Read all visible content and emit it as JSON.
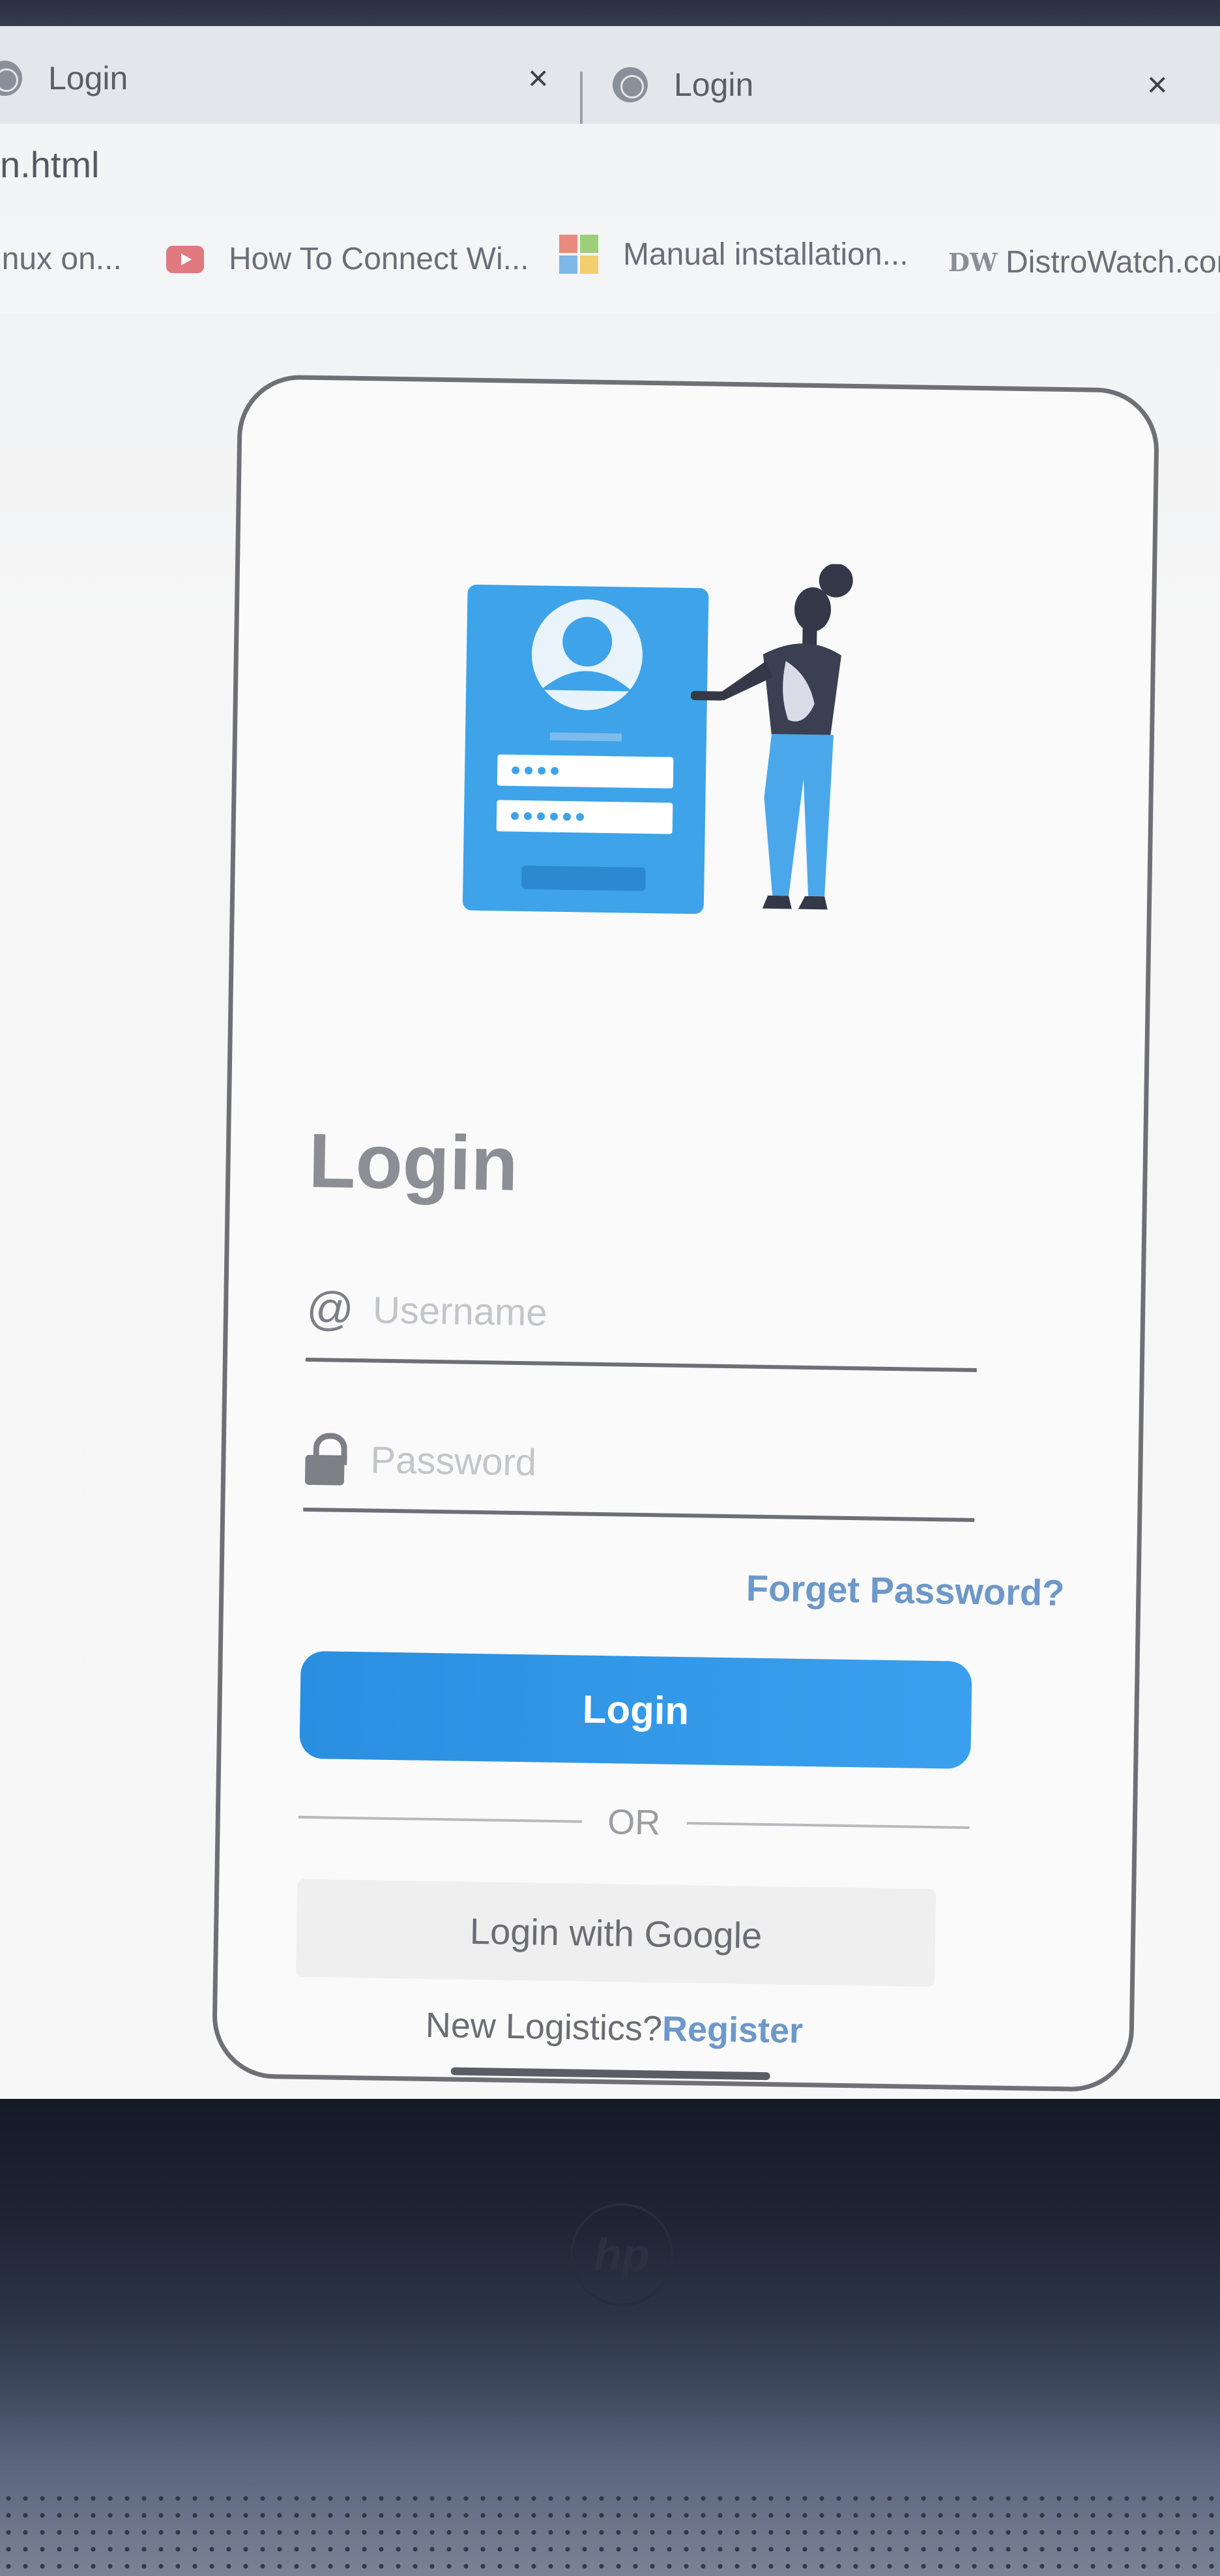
{
  "browser": {
    "tabs": [
      {
        "label": "Login"
      },
      {
        "label": "Login"
      }
    ],
    "tab_close_glyph": "×",
    "url": "n.html",
    "bookmarks": [
      {
        "label": "inux on...",
        "icon": "none"
      },
      {
        "label": "How To Connect Wi...",
        "icon": "youtube-icon"
      },
      {
        "label": "Manual installation...",
        "icon": "microsoft-icon"
      },
      {
        "label": "DistroWatch.cor",
        "icon": "distrowatch-icon",
        "icon_text": "DW"
      }
    ]
  },
  "login": {
    "title": "Login",
    "username_icon": "@",
    "username_placeholder": "Username",
    "password_placeholder": "Password",
    "forgot_label": "Forget Password?",
    "login_button": "Login",
    "or_label": "OR",
    "google_button": "Login with Google",
    "register_prompt": "New Logistics?",
    "register_link": "Register"
  },
  "colors": {
    "accent": "#2a8fe0",
    "link": "#6d98c8",
    "illustration_blue": "#3ea3e8"
  },
  "laptop": {
    "brand_logo": "hp"
  }
}
